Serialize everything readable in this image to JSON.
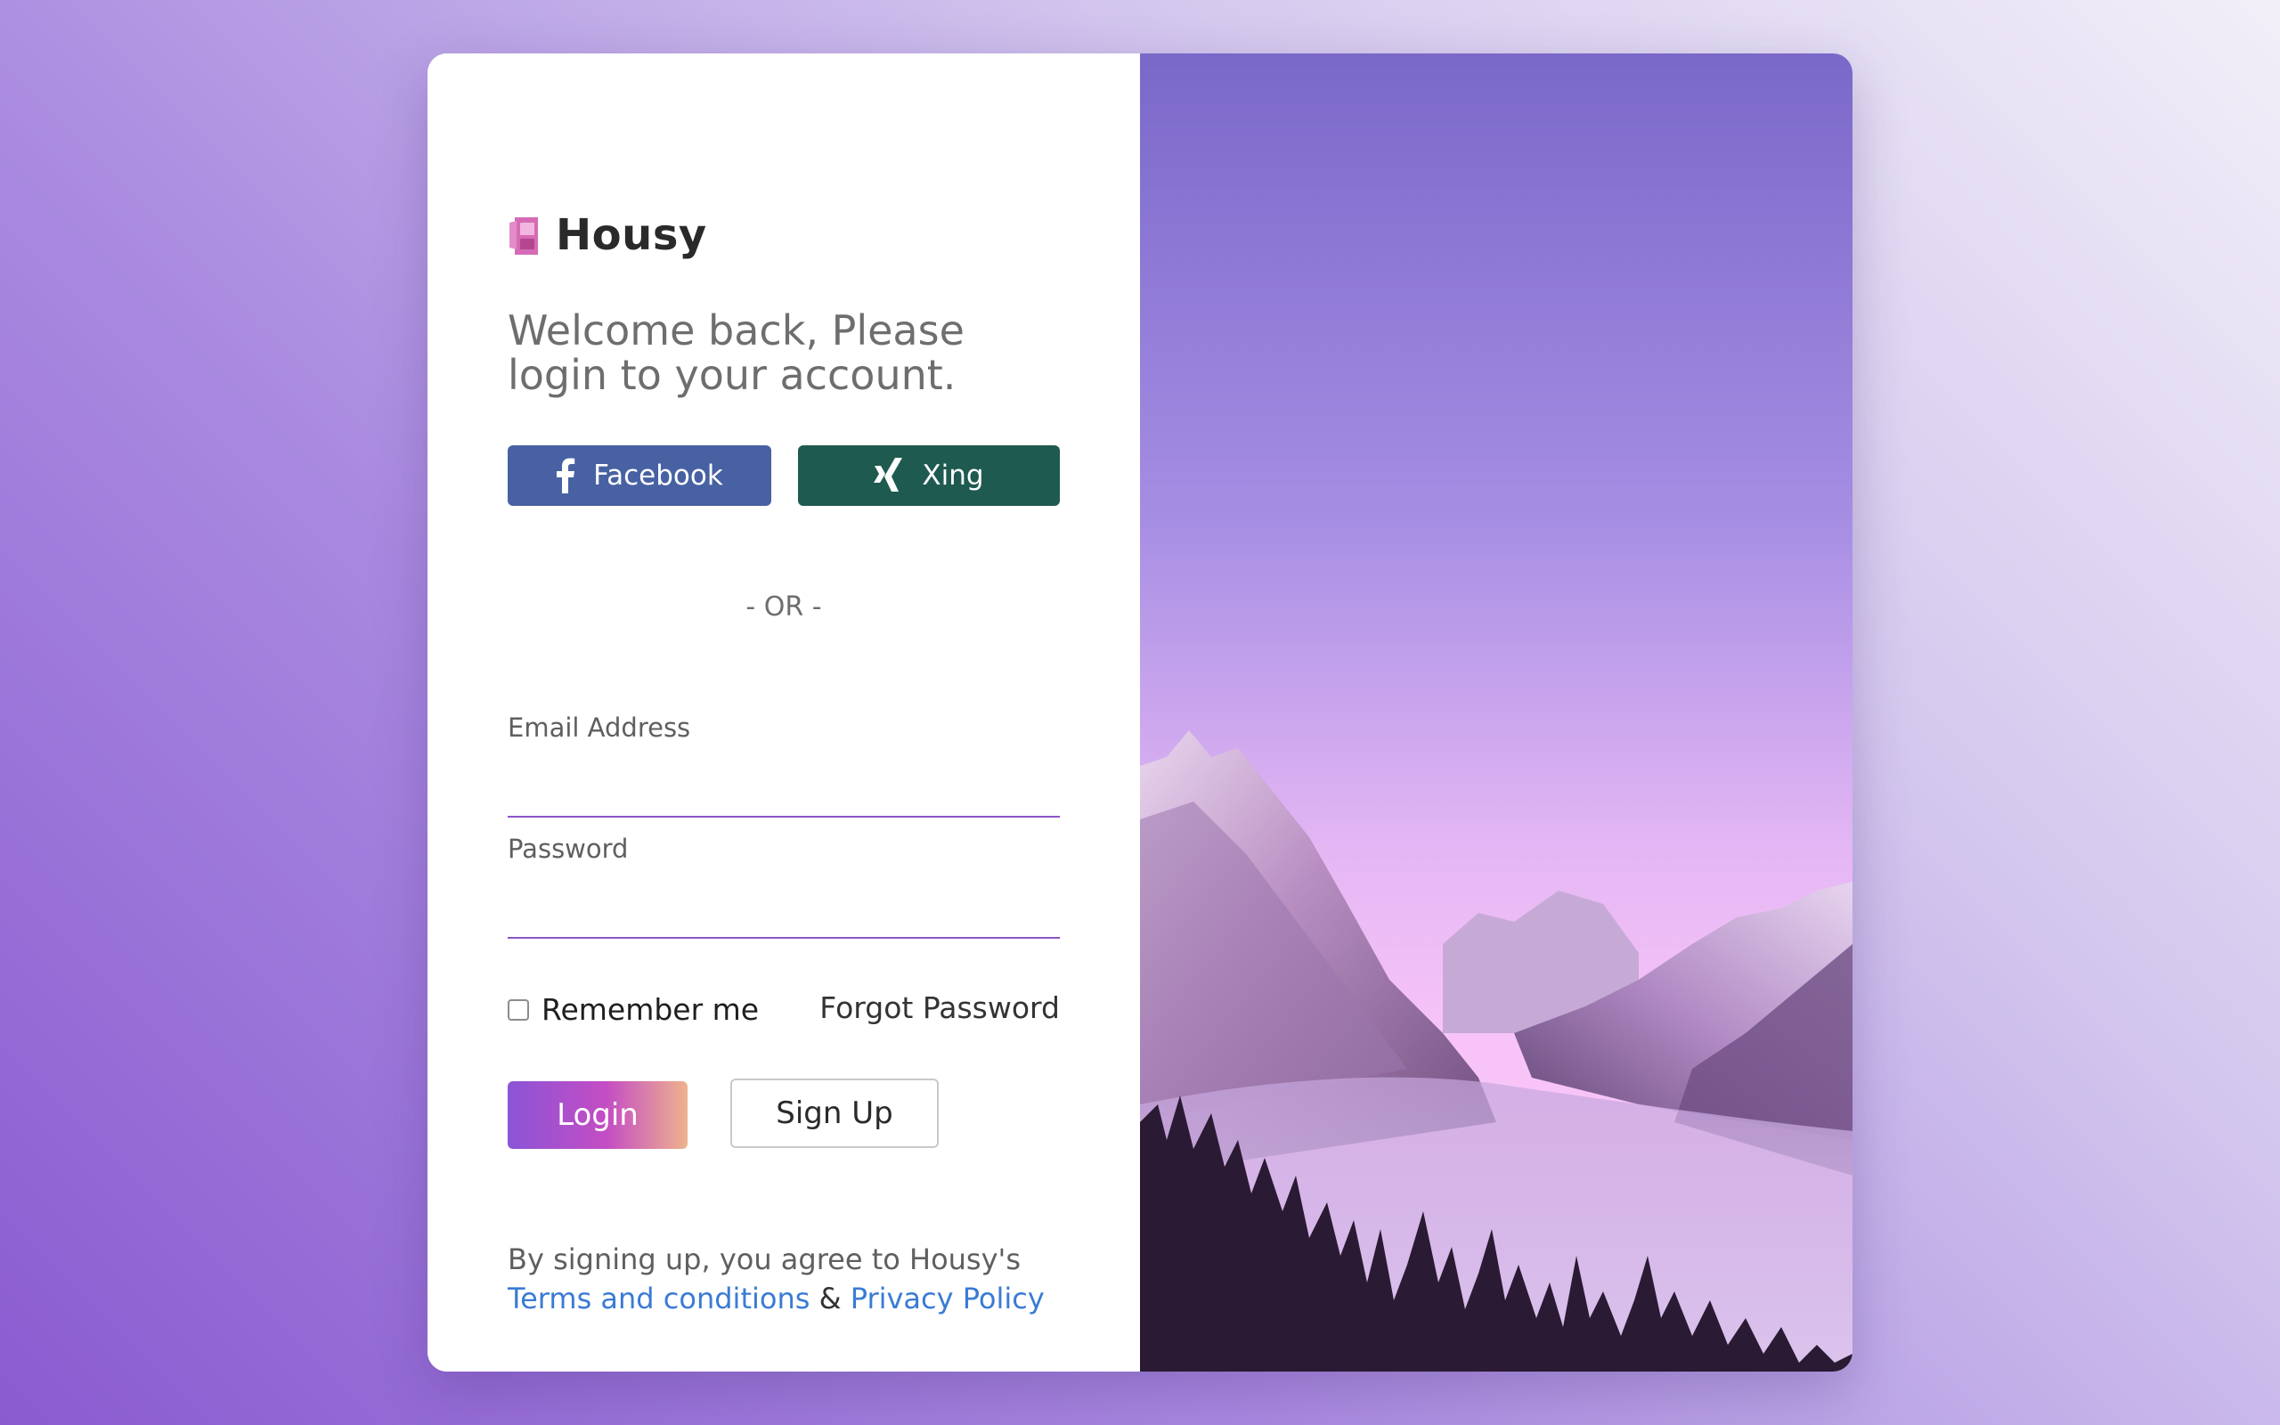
{
  "brand": {
    "name": "Housy",
    "icon": "phone-booth-icon",
    "icon_color": "#d66bb5"
  },
  "welcome": {
    "text": "Welcome back, Please login to your account."
  },
  "social": {
    "facebook_label": "Facebook",
    "facebook_icon": "facebook-icon",
    "facebook_color": "#4761a3",
    "xing_label": "Xing",
    "xing_icon": "xing-icon",
    "xing_color": "#1f5a50"
  },
  "divider": {
    "text": "- OR -"
  },
  "form": {
    "email_label": "Email Address",
    "email_value": "",
    "email_placeholder": "",
    "password_label": "Password",
    "password_value": "",
    "password_placeholder": "",
    "remember_label": "Remember me",
    "remember_checked": false,
    "forgot_label": "Forgot Password",
    "login_label": "Login",
    "signup_label": "Sign Up",
    "accent_color": "#8a55c9"
  },
  "terms": {
    "prefix": "By signing up, you agree to Housy's",
    "terms_link": "Terms and conditions",
    "ampersand": "&",
    "privacy_link": "Privacy Policy",
    "link_color": "#3a7bd5"
  },
  "hero": {
    "image": "mountain-valley-landscape",
    "sky_colors": [
      "#7a68c9",
      "#a98ee6",
      "#f4c2f6"
    ]
  }
}
